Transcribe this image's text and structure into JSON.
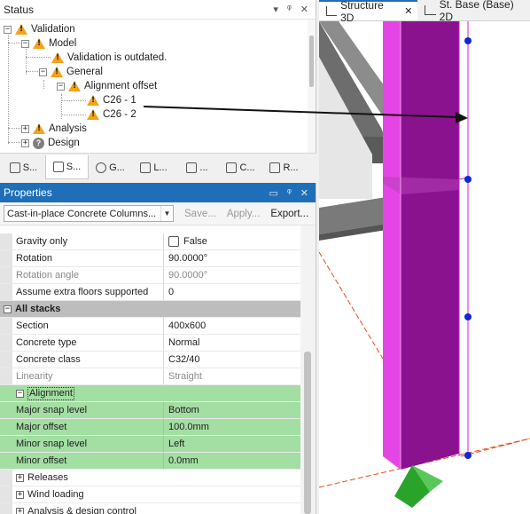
{
  "status_panel": {
    "title": "Status",
    "pin_glyph": "▾",
    "dock_glyph": "📌",
    "close_glyph": "✕",
    "tree": [
      {
        "label": "Validation",
        "icon": "warning-icon",
        "toggle": "−"
      },
      {
        "label": "Model",
        "icon": "warning-icon",
        "toggle": "−"
      },
      {
        "label": "Validation is outdated.",
        "icon": "warning-icon"
      },
      {
        "label": "General",
        "icon": "warning-icon",
        "toggle": "−"
      },
      {
        "label": "Alignment offset",
        "icon": "warning-icon",
        "toggle": "−"
      },
      {
        "label": "C26 - 1",
        "icon": "warning-icon"
      },
      {
        "label": "C26 - 2",
        "icon": "warning-icon"
      },
      {
        "label": "Analysis",
        "icon": "warning-icon",
        "toggle": "+"
      },
      {
        "label": "Design",
        "icon": "question-icon",
        "toggle": "+"
      }
    ],
    "tabs": [
      "S...",
      "S...",
      "G...",
      "L...",
      "...",
      "C...",
      "R..."
    ]
  },
  "properties_panel": {
    "title": "Properties",
    "object_select": "Cast-in-place Concrete Columns...",
    "toolbar": {
      "save": "Save...",
      "apply": "Apply...",
      "export": "Export..."
    },
    "rows": [
      {
        "name": "Gravity only",
        "value": "False",
        "checkbox": true
      },
      {
        "name": "Rotation",
        "value": "90.0000°"
      },
      {
        "name": "Rotation angle",
        "value": "90.0000°",
        "readonly": true
      },
      {
        "name": "Assume extra floors supported",
        "value": "0"
      }
    ],
    "category_all_stacks": "All stacks",
    "stack_rows": [
      {
        "name": "Section",
        "value": "400x600"
      },
      {
        "name": "Concrete type",
        "value": "Normal"
      },
      {
        "name": "Concrete class",
        "value": "C32/40"
      },
      {
        "name": "Linearity",
        "value": "Straight",
        "readonly": true
      }
    ],
    "alignment": {
      "label": "Alignment",
      "rows": [
        {
          "name": "Major snap level",
          "value": "Bottom"
        },
        {
          "name": "Major offset",
          "value": "100.0mm"
        },
        {
          "name": "Minor snap level",
          "value": "Left"
        },
        {
          "name": "Minor offset",
          "value": "0.0mm"
        }
      ]
    },
    "collapsed_groups": [
      "Releases",
      "Wind loading",
      "Analysis & design control"
    ]
  },
  "view": {
    "tabs": [
      {
        "label": "Structure 3D",
        "close": "✕"
      },
      {
        "label": "St. Base (Base) 2D"
      }
    ]
  },
  "colors": {
    "warning": "#f4a11b",
    "properties_header": "#1f6fb8",
    "alignment_highlight": "#a3dea3",
    "column": "#d21ed2"
  }
}
